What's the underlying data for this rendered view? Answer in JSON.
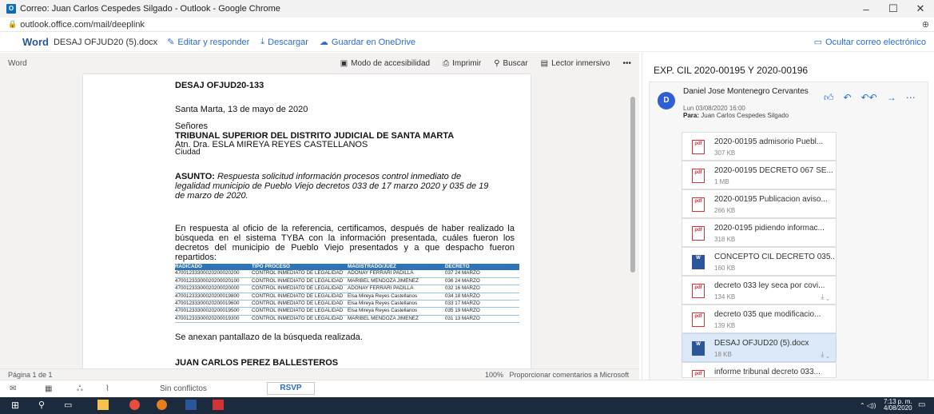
{
  "window": {
    "title": "Correo: Juan Carlos Cespedes Silgado - Outlook - Google Chrome",
    "url": "outlook.office.com/mail/deeplink"
  },
  "command_bar": {
    "app": "Word",
    "filename": "DESAJ OFJUD20 (5).docx",
    "edit": "Editar y responder",
    "download": "Descargar",
    "save": "Guardar en OneDrive",
    "hide": "Ocultar correo electrónico"
  },
  "viewer_toolbar": {
    "label": "Word",
    "accessibility": "Modo de accesibilidad",
    "print": "Imprimir",
    "search": "Buscar",
    "reader": "Lector inmersivo",
    "more": "•••"
  },
  "document": {
    "ref": "DESAJ OFJUD20-133",
    "place_date": "Santa Marta, 13 de mayo de 2020",
    "salutation": "Señores",
    "tribunal": "TRIBUNAL SUPERIOR DEL DISTRITO JUDICIAL DE SANTA MARTA",
    "atn": "Atn. Dra. ESLA MIREYA REYES CASTELLANOS",
    "city": "Ciudad",
    "asunto_label": "ASUNTO:",
    "asunto_text": "Respuesta solicitud información procesos control inmediato de legalidad municipio de Pueblo Viejo decretos 033 de 17 marzo 2020 y 035 de 19 de marzo de 2020.",
    "body": "En respuesta al oficio de la referencia, certificamos, después de haber realizado la búsqueda en el sistema TYBA con la información presentada, cuáles fueron los decretos del municipio de Pueblo Viejo presentados y a que despacho fueron repartidos:",
    "table_headers": [
      "RADICADO",
      "TIPO PROCESO",
      "MAGISTRADO/JUEZ",
      "DECRETO"
    ],
    "table_rows": [
      [
        "47001233300020200020200",
        "CONTROL INMEDIATO DE LEGALIDAD",
        "ADONAY FERRARI PADILLA",
        "037 24 MARZO"
      ],
      [
        "47001233300020200020100",
        "CONTROL INMEDIATO DE LEGALIDAD",
        "MARIBEL MENDOZA JIMENEZ",
        "036 24 MARZO"
      ],
      [
        "47001233300020200020000",
        "CONTROL INMEDIATO DE LEGALIDAD",
        "ADONAY FERRARI PADILLA",
        "032 16 MARZO"
      ],
      [
        "47001233300020200019800",
        "CONTROL INMEDIATO DE LEGALIDAD",
        "Elsa Mireya Reyes Castellanos",
        "034 18 MARZO"
      ],
      [
        "47001233300020200019600",
        "CONTROL INMEDIATO DE LEGALIDAD",
        "Elsa Mireya Reyes Castellanos",
        "033 17 MARZO"
      ],
      [
        "47001233300020200019500",
        "CONTROL INMEDIATO DE LEGALIDAD",
        "Elsa Mireya Reyes Castellanos",
        "035 19 MARZO"
      ],
      [
        "47001233300020200019300",
        "CONTROL INMEDIATO DE LEGALIDAD",
        "MARIBEL MENDOZA JIMENEZ",
        "031 13 MARZO"
      ]
    ],
    "annex": "Se anexan pantallazo de la búsqueda realizada.",
    "signer": "JUAN CARLOS PEREZ BALLESTEROS"
  },
  "status": {
    "page": "Página 1 de 1",
    "zoom": "100%",
    "feedback": "Proporcionar comentarios a Microsoft"
  },
  "email": {
    "subject": "EXP. CIL 2020-00195 Y 2020-00196",
    "avatar": "D",
    "sender": "Daniel Jose Montenegro Cervantes",
    "date": "Lun 03/08/2020 16:00",
    "to_label": "Para:",
    "to": "Juan Carlos Cespedes Silgado",
    "attachments": [
      {
        "name": "2020-00195 admisorio Puebl...",
        "size": "307 KB",
        "type": "pdf"
      },
      {
        "name": "2020-00195 DECRETO 067 SE...",
        "size": "1 MB",
        "type": "pdf"
      },
      {
        "name": "2020-00195 Publicacion aviso...",
        "size": "266 KB",
        "type": "pdf"
      },
      {
        "name": "2020-0195 pidiendo informac...",
        "size": "318 KB",
        "type": "pdf"
      },
      {
        "name": "CONCEPTO CIL DECRETO 035...",
        "size": "160 KB",
        "type": "doc"
      },
      {
        "name": "decreto 033 ley seca por covi...",
        "size": "134 KB",
        "type": "pdf"
      },
      {
        "name": "decreto 035 que modificacio...",
        "size": "139 KB",
        "type": "pdf"
      },
      {
        "name": "DESAJ OFJUD20 (5).docx",
        "size": "18 KB",
        "type": "doc"
      },
      {
        "name": "informe tribunal decreto 033...",
        "size": "",
        "type": "pdf"
      }
    ]
  },
  "bottom": {
    "conflicts": "Sin conflictos",
    "rsvp": "RSVP"
  },
  "taskbar": {
    "time": "7:13 p. m.",
    "date": "4/08/2020"
  }
}
